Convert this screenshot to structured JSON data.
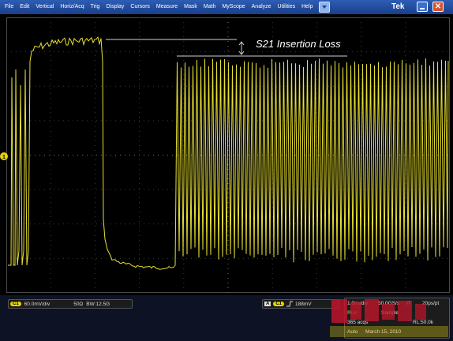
{
  "menu": {
    "items": [
      "File",
      "Edit",
      "Vertical",
      "Horiz/Acq",
      "Trig",
      "Display",
      "Cursors",
      "Measure",
      "Mask",
      "Math",
      "MyScope",
      "Analyze",
      "Utilities",
      "Help"
    ],
    "brand": "Tek",
    "close_symbol": "✕"
  },
  "display": {
    "annotation": "S21 Insertion Loss",
    "ground_marker": "1",
    "trace_color": "#e8e030"
  },
  "status": {
    "channel": {
      "badge": "C1",
      "scale": "60.0mV/div",
      "impedance": "50Ω",
      "bandwidth": "BW:12.5G"
    },
    "trigger": {
      "source_letter": "A",
      "badge": "C1",
      "level": "188mV"
    },
    "acquisition": {
      "timebase": "1.0ns/div",
      "sample_rate": "50.0GS/s",
      "ppt": "IT",
      "resolution": "20ps/pt",
      "state": "Run",
      "mode": "Sample",
      "acqs": "365 acqs",
      "record_length": "RL:50.0k",
      "trig_mode": "Auto",
      "date": "March 15, 2010"
    }
  }
}
